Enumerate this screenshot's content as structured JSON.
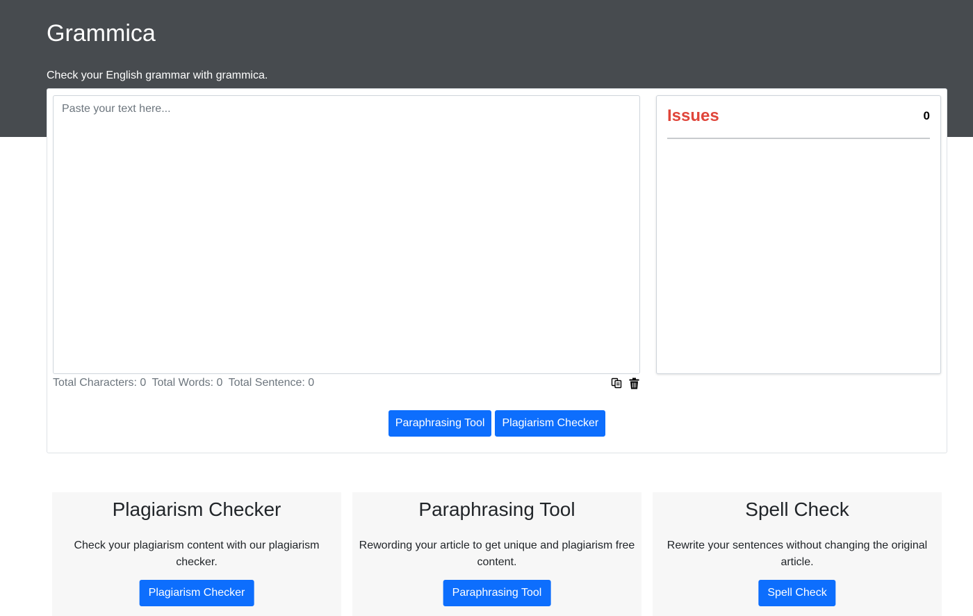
{
  "header": {
    "brand": "Grammica",
    "tagline": "Check your English grammar with grammica."
  },
  "editor": {
    "placeholder": "Paste your text here...",
    "value": ""
  },
  "stats": {
    "characters": "Total Characters: 0",
    "words": "Total Words: 0",
    "sentences": "Total Sentence: 0"
  },
  "icons": {
    "copy": "copy-icon",
    "delete": "trash-icon"
  },
  "issues": {
    "title": "Issues",
    "count": "0"
  },
  "actions": {
    "paraphrasing": "Paraphrasing Tool",
    "plagiarism": "Plagiarism Checker"
  },
  "features": [
    {
      "title": "Plagiarism Checker",
      "description": "Check your plagiarism content with our plagiarism checker.",
      "button": "Plagiarism Checker"
    },
    {
      "title": "Paraphrasing Tool",
      "description": "Rewording your article to get unique and plagiarism free content.",
      "button": "Paraphrasing Tool"
    },
    {
      "title": "Spell Check",
      "description": "Rewrite your sentences without changing the original article.",
      "button": "Spell Check"
    }
  ],
  "colors": {
    "header_bg": "#474b4f",
    "primary": "#0d6efd",
    "issues_title": "#e0453a",
    "feature_bg": "#f7f7f7"
  }
}
